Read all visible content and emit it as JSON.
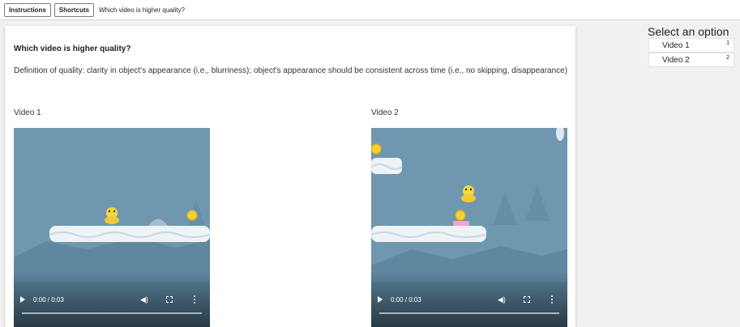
{
  "topbar": {
    "instructions_label": "Instructions",
    "shortcuts_label": "Shortcuts",
    "title": "Which video is higher quality?"
  },
  "main": {
    "question": "Which video is higher quality?",
    "definition": "Definition of quality: clarity in object's appearance (i.e., blurriness); object's appearance should be consistent across time (i.e., no skipping, disappearance)",
    "videos": [
      {
        "label": "Video 1",
        "time": "0:00 / 0:03"
      },
      {
        "label": "Video 2",
        "time": "0:00 / 0:03"
      }
    ]
  },
  "options": {
    "title": "Select an option",
    "items": [
      {
        "label": "Video 1",
        "key": "1"
      },
      {
        "label": "Video 2",
        "key": "2"
      }
    ]
  },
  "icons": [
    "play-icon",
    "volume-icon",
    "fullscreen-icon",
    "more-options-icon"
  ],
  "colors": {
    "video_sky": "#6f97b0",
    "platform": "#eef3f6",
    "character": "#f3d23a"
  }
}
